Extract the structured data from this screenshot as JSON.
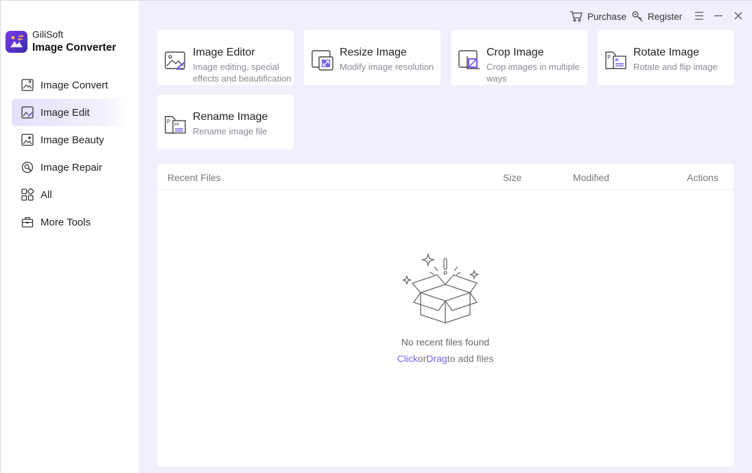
{
  "app": {
    "brand_top": "GiliSoft",
    "brand_main": "Image Converter"
  },
  "sidebar": {
    "items": [
      {
        "label": "Image Convert",
        "icon": "image-convert-icon",
        "active": false
      },
      {
        "label": "Image Edit",
        "icon": "image-edit-icon",
        "active": true
      },
      {
        "label": "Image Beauty",
        "icon": "image-beauty-icon",
        "active": false
      },
      {
        "label": "Image Repair",
        "icon": "image-repair-icon",
        "active": false
      },
      {
        "label": "All",
        "icon": "grid-icon",
        "active": false
      },
      {
        "label": "More Tools",
        "icon": "toolbox-icon",
        "active": false
      }
    ]
  },
  "topbar": {
    "purchase": "Purchase",
    "register": "Register"
  },
  "tools": [
    {
      "title": "Image Editor",
      "desc": "Image editing, special effects and beautification"
    },
    {
      "title": "Resize Image",
      "desc": "Modify image resolution"
    },
    {
      "title": "Crop Image",
      "desc": "Crop images in multiple ways"
    },
    {
      "title": "Rotate Image",
      "desc": "Rotate and flip image"
    },
    {
      "title": "Rename Image",
      "desc": "Rename image file"
    }
  ],
  "recent": {
    "columns": {
      "name": "Recent Files",
      "size": "Size",
      "modified": "Modified",
      "actions": "Actions"
    },
    "empty_text": "No recent files found",
    "click": "Click",
    "or": "or",
    "drag": "Drag",
    "suffix": "to add files"
  },
  "colors": {
    "accent": "#7a5ef0",
    "background": "#eff0fb",
    "active_nav": "#e6e0fb"
  }
}
